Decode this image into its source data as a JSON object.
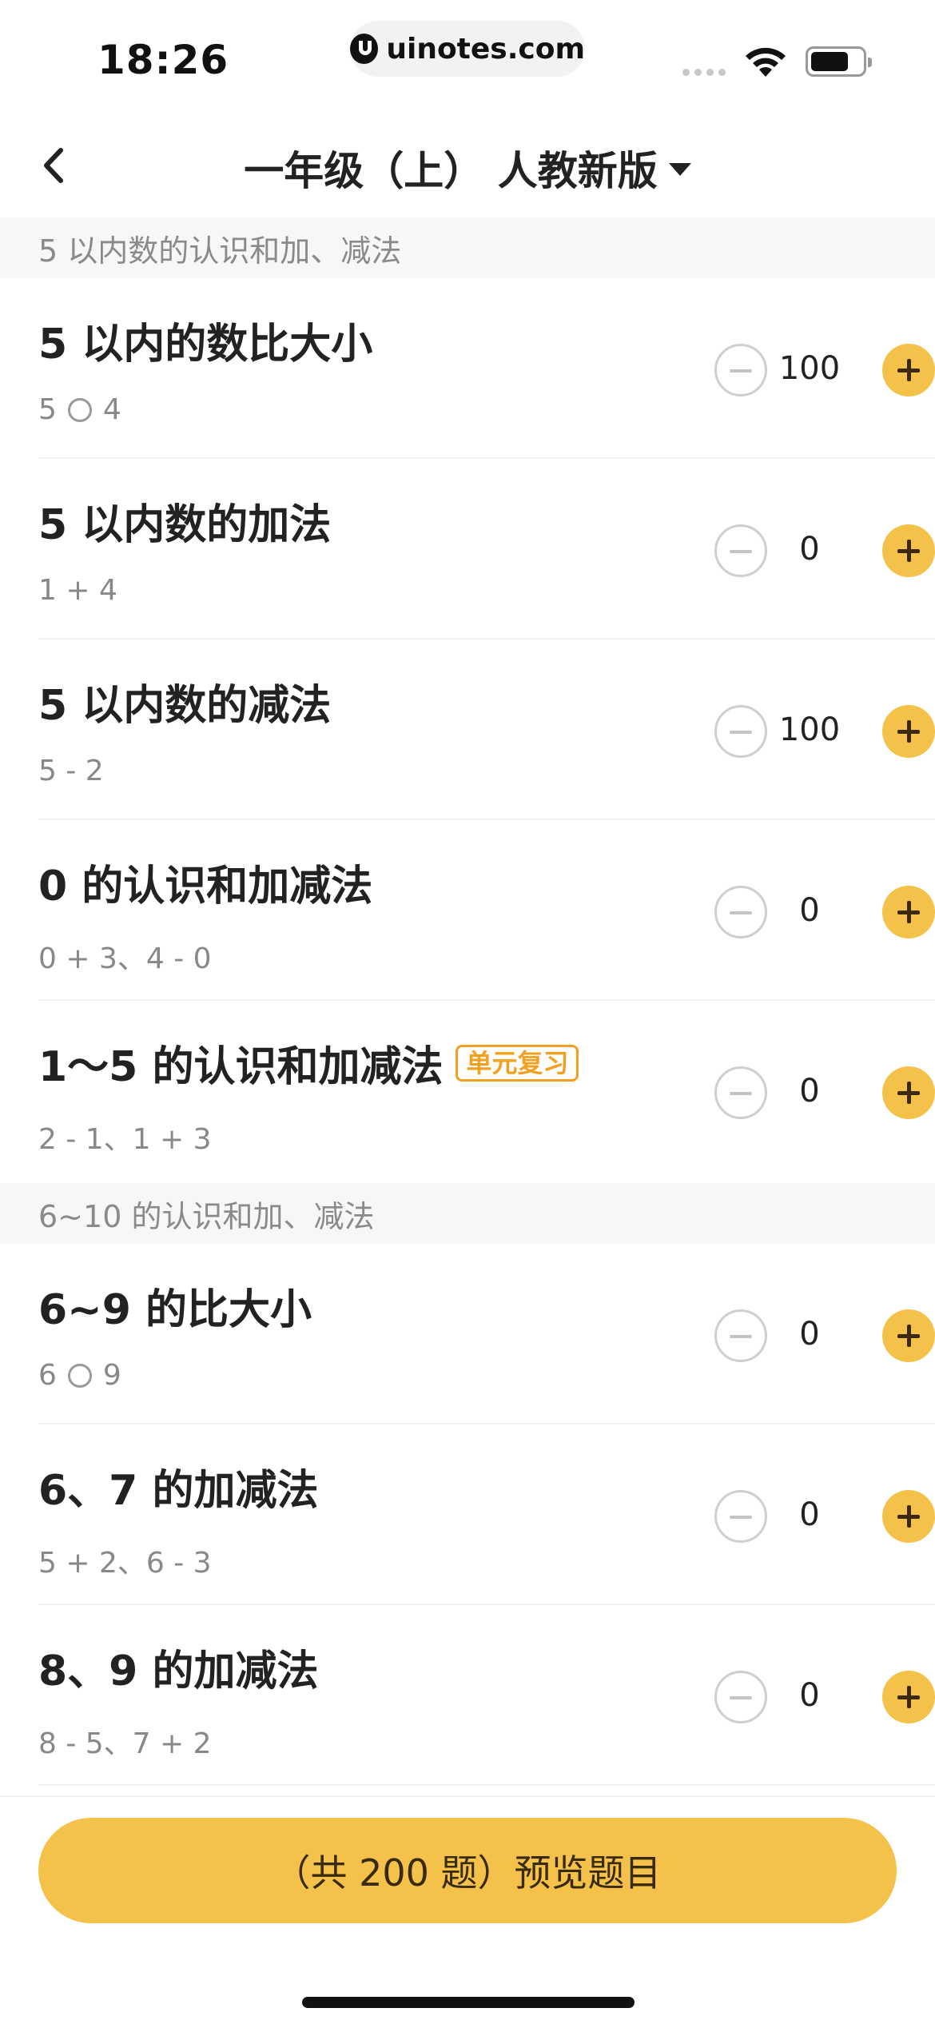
{
  "status_bar": {
    "time": "18:26",
    "url": "uinotes.com"
  },
  "nav": {
    "title": "一年级（上） 人教新版"
  },
  "sections": [
    {
      "header": "5 以内数的认识和加、减法",
      "items": [
        {
          "title": "5 以内的数比大小",
          "sub_left": "5",
          "sub_right": "4",
          "compare": true,
          "count": "100"
        },
        {
          "title": "5 以内数的加法",
          "sub": "1 + 4",
          "count": "0"
        },
        {
          "title": "5 以内数的减法",
          "sub": "5 - 2",
          "count": "100"
        },
        {
          "title": "0 的认识和加减法",
          "sub": "0 + 3、4 - 0",
          "count": "0"
        },
        {
          "title": "1～5 的认识和加减法",
          "badge": "单元复习",
          "sub": "2 - 1、1 + 3",
          "count": "0"
        }
      ]
    },
    {
      "header": "6~10 的认识和加、减法",
      "items": [
        {
          "title": "6~9 的比大小",
          "sub_left": "6",
          "sub_right": "9",
          "compare": true,
          "count": "0"
        },
        {
          "title": "6、7 的加减法",
          "sub": "5 + 2、6 - 3",
          "count": "0"
        },
        {
          "title": "8、9 的加减法",
          "sub": "8 - 5、7 + 2",
          "count": "0"
        }
      ]
    }
  ],
  "footer": {
    "preview_label": "（共 200 题）预览题目"
  },
  "colors": {
    "accent": "#f4c24b",
    "badge": "#f3a020"
  }
}
